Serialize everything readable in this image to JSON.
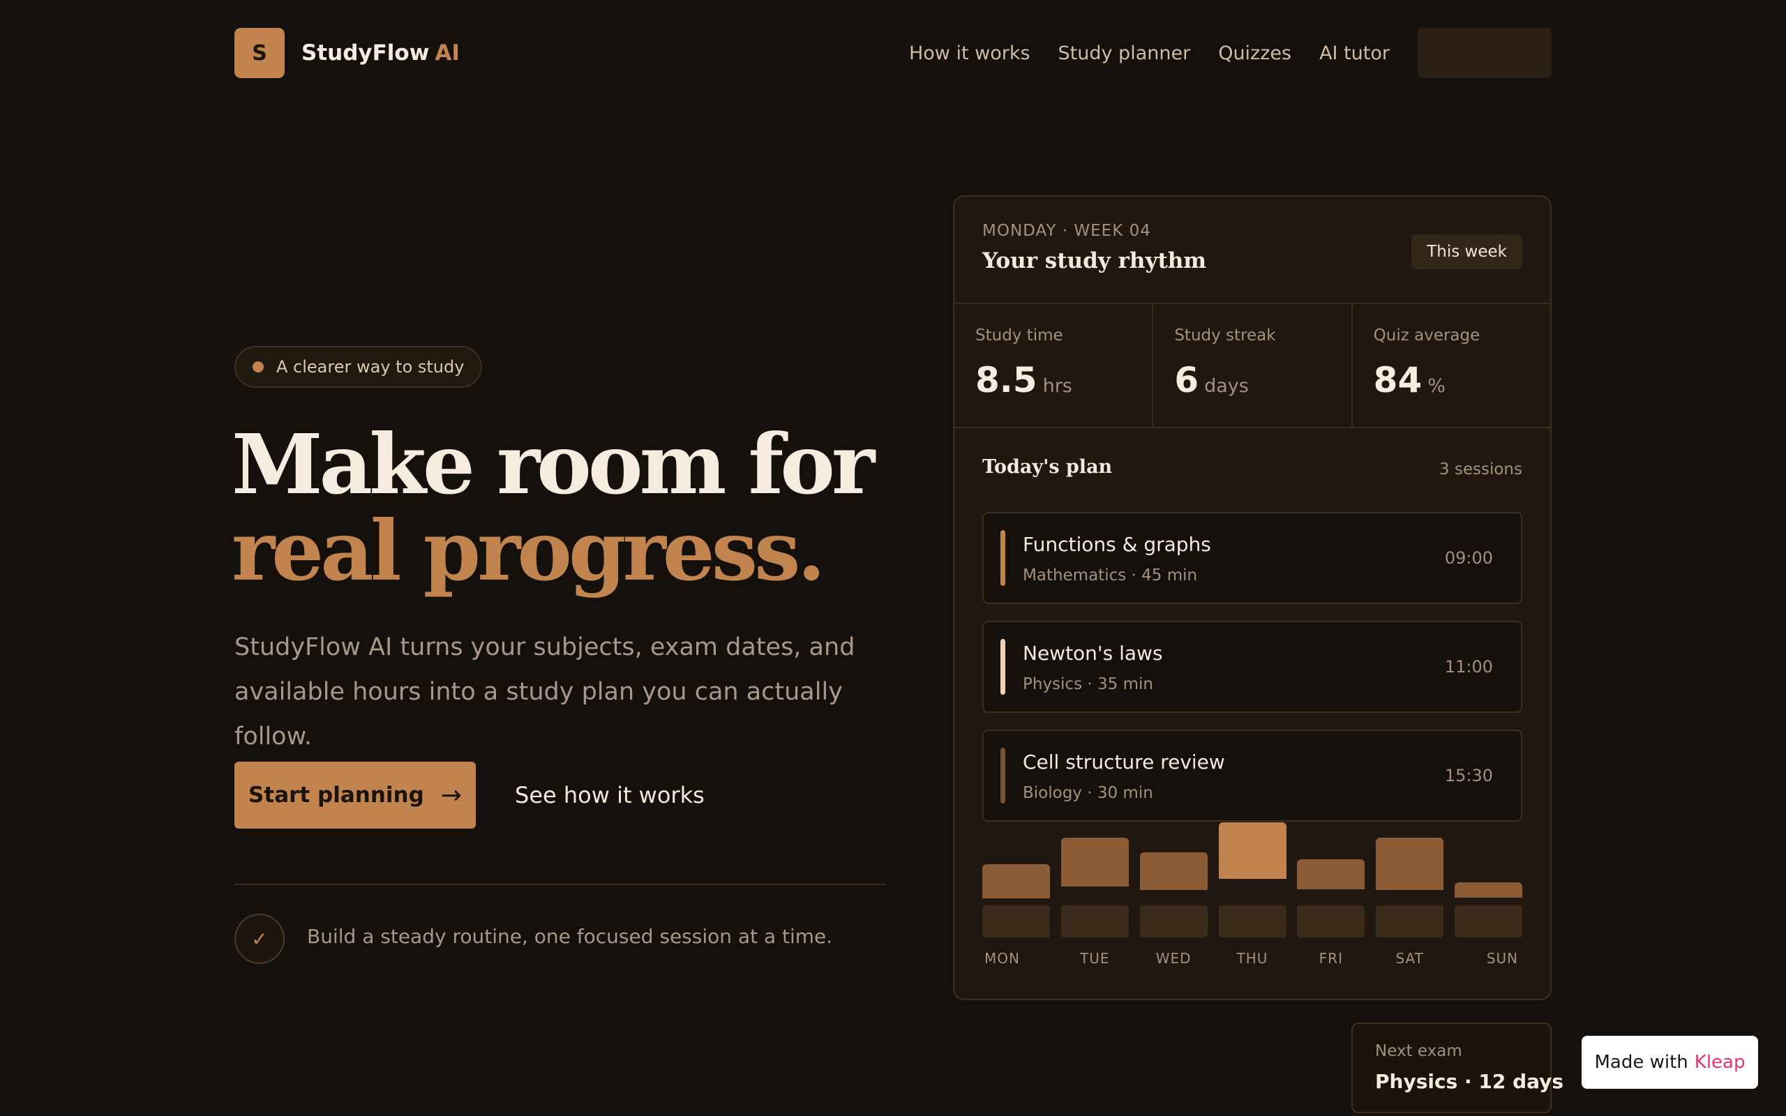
{
  "nav": {
    "logo_letter": "S",
    "brand_name": "StudyFlow",
    "brand_suffix": "AI",
    "links": [
      "How it works",
      "Study planner",
      "Quizzes",
      "AI tutor"
    ],
    "cta_label": ""
  },
  "hero": {
    "pill": "A clearer way to study",
    "headline_line1": "Make room for",
    "headline_line2": "real progress.",
    "lead": "StudyFlow AI turns your subjects, exam dates, and available hours into a study plan you can actually follow.",
    "primary_button": "Start planning",
    "primary_arrow": "→",
    "secondary_button": "See how it works",
    "check_icon": "✓",
    "footnote": "Build a steady routine, one focused session at a time."
  },
  "dashboard": {
    "eyebrow": "MONDAY · WEEK 04",
    "title": "Your study rhythm",
    "badge": "This week",
    "stats": [
      {
        "label": "Study time",
        "value": "8.5",
        "unit": "hrs"
      },
      {
        "label": "Study streak",
        "value": "6",
        "unit": "days"
      },
      {
        "label": "Quiz average",
        "value": "84",
        "unit": "%"
      }
    ],
    "plan_title": "Today's plan",
    "plan_count": "3 sessions",
    "sessions": [
      {
        "name": "Functions & graphs",
        "meta": "Mathematics · 45 min",
        "time": "09:00",
        "color": "#c1844f"
      },
      {
        "name": "Newton's laws",
        "meta": "Physics · 35 min",
        "time": "11:00",
        "color": "#f0d2b0"
      },
      {
        "name": "Cell structure review",
        "meta": "Biology · 30 min",
        "time": "15:30",
        "color": "#7a5232"
      }
    ],
    "chart_data": {
      "type": "bar",
      "categories": [
        "MON",
        "TUE",
        "WED",
        "THU",
        "FRI",
        "SAT",
        "SUN"
      ],
      "values": [
        0.45,
        0.65,
        0.5,
        0.75,
        0.4,
        0.7,
        0.2
      ],
      "secondary_values": [
        0.73,
        1.0,
        0.85,
        1.15,
        0.78,
        1.0,
        0.55
      ],
      "colors": {
        "bar": "#8c5c36",
        "highlight": "#c1844f",
        "shadow": "#3a2b1b"
      },
      "highlight_index": 3
    }
  },
  "exam": {
    "label": "Next exam",
    "value": "Physics · 12 days"
  },
  "made_with": {
    "prefix": "Made with",
    "brand": "Kleap"
  }
}
